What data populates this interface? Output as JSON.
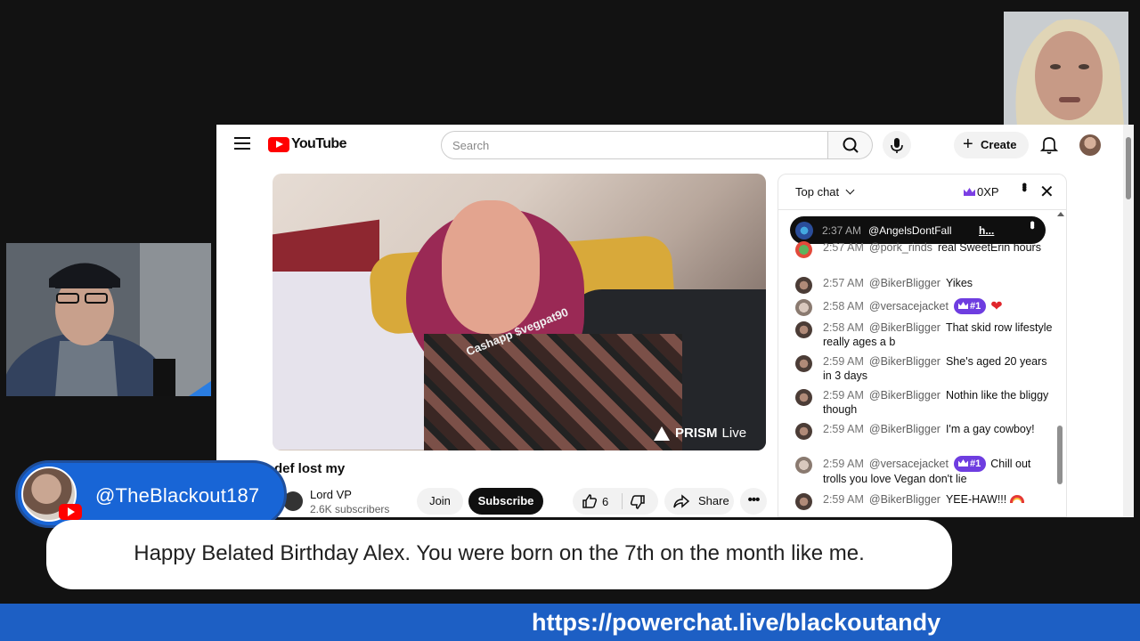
{
  "browser": {
    "logo_text": "YouTube",
    "search_placeholder": "Search",
    "create_label": "Create",
    "icons": [
      "menu-icon",
      "search-icon",
      "mic-icon",
      "plus-icon",
      "bell-icon"
    ]
  },
  "video": {
    "watermark": "Cashapp $vegpat90",
    "live_brand_bold": "PRISM",
    "live_brand_rest": "Live",
    "title": "def lost my",
    "channel_name": "Lord VP",
    "subscribers": "2.6K subscribers",
    "join_label": "Join",
    "subscribe_label": "Subscribe",
    "like_count": "6",
    "share_label": "Share"
  },
  "chat": {
    "mode_label": "Top chat",
    "xp_label": "0XP",
    "pinned": {
      "time": "2:37 AM",
      "author": "@AngelsDontFall",
      "message": "h..."
    },
    "messages": [
      {
        "time": "2:57 AM",
        "author": "@pork_rinds",
        "text": "real SweetErin hours",
        "badge": "",
        "emoji": ""
      },
      {
        "time": "2:57 AM",
        "author": "@BikerBligger",
        "text": "Yikes",
        "badge": "",
        "emoji": ""
      },
      {
        "time": "2:58 AM",
        "author": "@versacejacket",
        "text": "",
        "badge": "#1",
        "emoji": "heart"
      },
      {
        "time": "2:58 AM",
        "author": "@BikerBligger",
        "text": "That skid row lifestyle really ages a b",
        "badge": "",
        "emoji": ""
      },
      {
        "time": "2:59 AM",
        "author": "@BikerBligger",
        "text": "She's aged 20 years in 3 days",
        "badge": "",
        "emoji": ""
      },
      {
        "time": "2:59 AM",
        "author": "@BikerBligger",
        "text": "Nothin like the bliggy though",
        "badge": "",
        "emoji": ""
      },
      {
        "time": "2:59 AM",
        "author": "@BikerBligger",
        "text": "I'm a gay cowboy!",
        "badge": "",
        "emoji": ""
      },
      {
        "time": "2:59 AM",
        "author": "@versacejacket",
        "text": "Chill out trolls you love Vegan don't lie",
        "badge": "#1",
        "emoji": ""
      },
      {
        "time": "2:59 AM",
        "author": "@BikerBligger",
        "text": "YEE-HAW!!!",
        "badge": "",
        "emoji": "rainbow"
      }
    ]
  },
  "overlay": {
    "username": "@TheBlackout187",
    "message": "Happy Belated Birthday Alex. You were born on the 7th on the month like me.",
    "link": "https://powerchat.live/blackoutandy"
  },
  "colors": {
    "youtube_red": "#ff0000",
    "member_badge": "#6e3de0",
    "overlay_blue": "#1865d6",
    "link_bar": "#1d5fc4"
  }
}
